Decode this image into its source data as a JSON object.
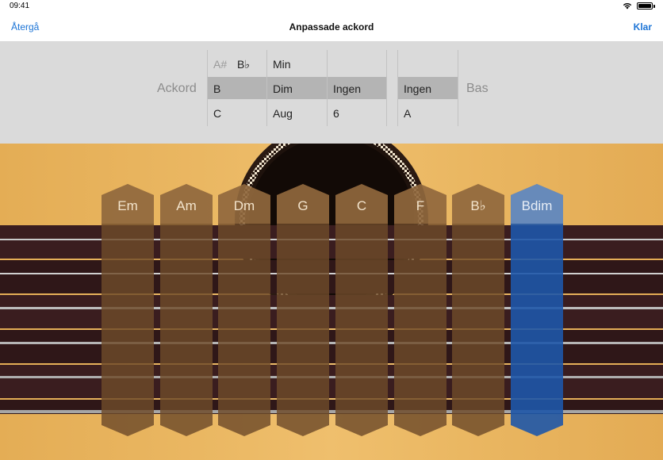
{
  "status_bar": {
    "time": "09:41"
  },
  "nav": {
    "back_label": "Återgå",
    "title": "Anpassade ackord",
    "done_label": "Klar"
  },
  "picker": {
    "chord_label": "Ackord",
    "bass_label": "Bas",
    "root": {
      "above_a": "A#",
      "above_b": "B♭",
      "selected": "B",
      "below": "C"
    },
    "quality": {
      "above": "Min",
      "selected": "Dim",
      "below": "Aug"
    },
    "extension": {
      "selected": "Ingen",
      "below": "6"
    },
    "bass": {
      "selected": "Ingen",
      "below": "A"
    }
  },
  "chords": [
    {
      "label": "Em",
      "active": false
    },
    {
      "label": "Am",
      "active": false
    },
    {
      "label": "Dm",
      "active": false
    },
    {
      "label": "G",
      "active": false
    },
    {
      "label": "C",
      "active": false
    },
    {
      "label": "F",
      "active": false
    },
    {
      "label": "B♭",
      "active": false
    },
    {
      "label": "Bdim",
      "active": true
    }
  ],
  "colors": {
    "accent_blue": "#1c74d6",
    "chord_strip": "#6e4a2a",
    "chord_active": "#1e56a8",
    "fretboard": "#3a1f1f",
    "guitar_body": "#ebb866"
  }
}
